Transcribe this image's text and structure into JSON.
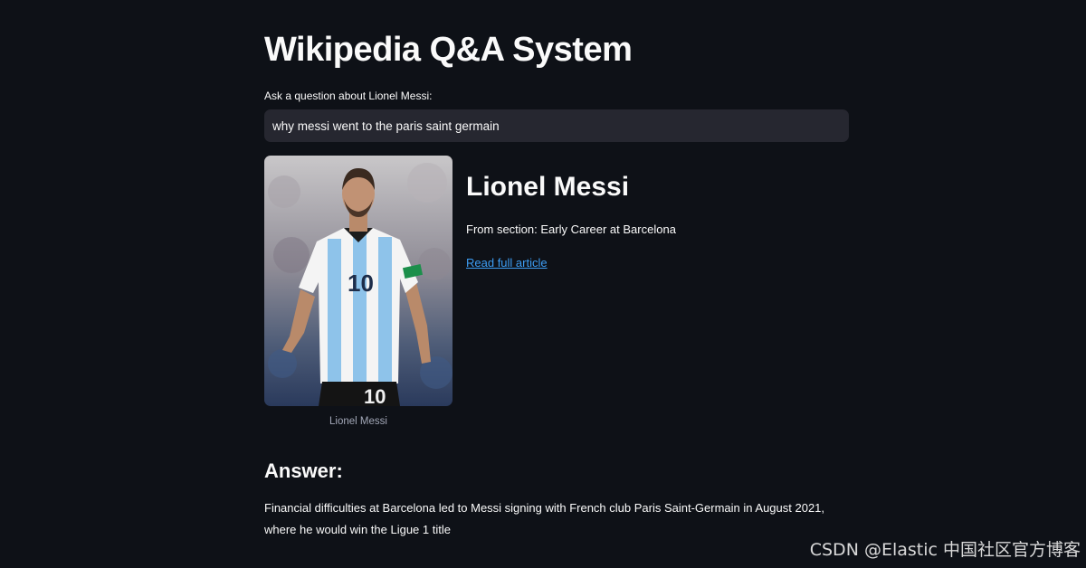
{
  "page": {
    "title": "Wikipedia Q&A System"
  },
  "question": {
    "label": "Ask a question about Lionel Messi:",
    "value": "why messi went to the paris saint germain"
  },
  "article": {
    "image_caption": "Lionel Messi",
    "title": "Lionel Messi",
    "section": "From section: Early Career at Barcelona",
    "link_label": "Read full article"
  },
  "answer": {
    "heading": "Answer:",
    "text": "Financial difficulties at Barcelona led to Messi signing with French club Paris Saint-Germain in August 2021, where he would win the Ligue 1 title"
  },
  "watermark": "CSDN @Elastic 中国社区官方博客",
  "colors": {
    "background": "#0e1117",
    "input_background": "#262730",
    "link": "#3d9df3",
    "jersey_blue": "#8ec3ea"
  }
}
